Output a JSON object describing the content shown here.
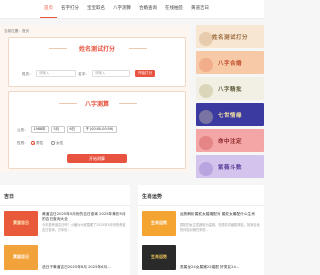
{
  "nav": {
    "items": [
      {
        "label": "首页",
        "active": true
      },
      {
        "label": "名字打分",
        "active": false
      },
      {
        "label": "宝宝取名",
        "active": false
      },
      {
        "label": "八字测算",
        "active": false
      },
      {
        "label": "合婚查询",
        "active": false
      },
      {
        "label": "在线抽签",
        "active": false
      },
      {
        "label": "黄道吉日",
        "active": false
      }
    ]
  },
  "breadcrumb": "当前位置：首页",
  "name_test": {
    "title": "姓名测试打分",
    "surname_label": "姓氏：",
    "surname_placeholder": "请输入",
    "name_label": "名字：",
    "name_placeholder": "请输入",
    "submit_label": "开始打分"
  },
  "bazi": {
    "title": "八字测算",
    "calendar_label": "公历：",
    "year": "1988年",
    "month": "5月",
    "day": "6日",
    "hour": "子 (00:00-00:59)",
    "gender_label": "性别：",
    "gender_male": "男性",
    "gender_female": "女性",
    "gender_selected": "男性",
    "submit_label": "开始测算"
  },
  "banners": [
    {
      "label": "姓名测试打分",
      "bg": "#f7e6d2",
      "fg": "#9b6a3c"
    },
    {
      "label": "八字合婚",
      "bg": "#f7c9a6",
      "fg": "#c04a2a"
    },
    {
      "label": "八字精批",
      "bg": "#f2f0e4",
      "fg": "#5f5a3a"
    },
    {
      "label": "七世情缘",
      "bg": "#3a3aa0",
      "fg": "#f3e3a5"
    },
    {
      "label": "命中注定",
      "bg": "#f4a5a5",
      "fg": "#8c2a2a"
    },
    {
      "label": "紫薇斗数",
      "bg": "#d2c4ec",
      "fg": "#5b3e9a"
    }
  ],
  "section_left": {
    "title": "吉日",
    "articles": [
      {
        "thumb": "黄道吉日",
        "title": "黄道吉日2025年5月份的吉日查询 2025年黄历5月的吉日查询大全",
        "desc": "今天是黄道吉日吗？小编为大家整理了2025年5月份的黄道吉日查询，万年历..."
      },
      {
        "thumb": "黄道吉日",
        "title": "选日子黄道吉日2025年6月 2025年6月...",
        "desc": ""
      }
    ]
  },
  "section_right": {
    "title": "生肖运势",
    "articles": [
      {
        "thumb": "生肖运势",
        "title": "运势解析属蛇女婚姻配对 属蛇女最配什么生肖",
        "desc": "属蛇的女生性格较为温婉，在感情中细腻体贴，找到合适的伴侣对她们来说..."
      },
      {
        "thumb": "生肖运势",
        "title": "男属龙24女属猪22婚配 好男友24...",
        "desc": ""
      }
    ]
  }
}
